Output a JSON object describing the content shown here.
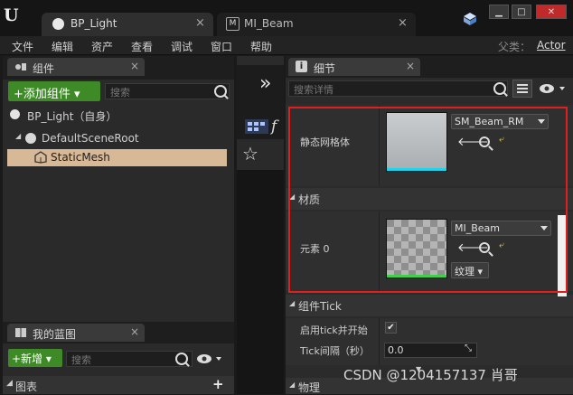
{
  "titlebar": {
    "logo": "U",
    "tabs": [
      {
        "label": "BP_Light",
        "close": "×",
        "icon": "blueprint-actor-icon"
      },
      {
        "label": "MI_Beam",
        "close": "×",
        "icon": "material-instance-icon"
      }
    ],
    "window_buttons": [
      "▁",
      "□",
      "✕"
    ]
  },
  "menubar": {
    "items": [
      "文件",
      "编辑",
      "资产",
      "查看",
      "调试",
      "窗口",
      "帮助"
    ],
    "parent_label": "父类：",
    "parent_value": "Actor"
  },
  "components_panel": {
    "tab_label": "组件",
    "add_button": "+添加组件 ▾",
    "search_placeholder": "搜索",
    "root_item": "BP_Light（自身）",
    "tree": [
      {
        "label": "DefaultSceneRoot"
      },
      {
        "label": "StaticMesh",
        "selected": true
      }
    ]
  },
  "my_blueprint_panel": {
    "tab_label": "我的蓝图",
    "new_button": "+新增 ▾",
    "search_placeholder": "搜索",
    "section": "图表",
    "add": "+"
  },
  "middle": {
    "chevron": "»",
    "text_f": "f"
  },
  "details_panel": {
    "tab_label": "细节",
    "search_placeholder": "搜索详情",
    "static_mesh_label": "静态网格体",
    "static_mesh_value": "SM_Beam_RM",
    "materials_section": "材质",
    "element_label": "元素 0",
    "material_value": "MI_Beam",
    "texture_button": "纹理 ▾",
    "tick_section": "组件Tick",
    "tick_start_label": "启用tick并开始",
    "tick_start_checked": true,
    "tick_interval_label": "Tick间隔（秒）",
    "tick_interval_value": "0.0",
    "physics_section": "物理"
  },
  "watermark": "CSDN @1204157137 肖哥",
  "colors": {
    "accent_green": "#3d8a26",
    "highlight_red": "#e02020",
    "selection": "#d8b997"
  }
}
